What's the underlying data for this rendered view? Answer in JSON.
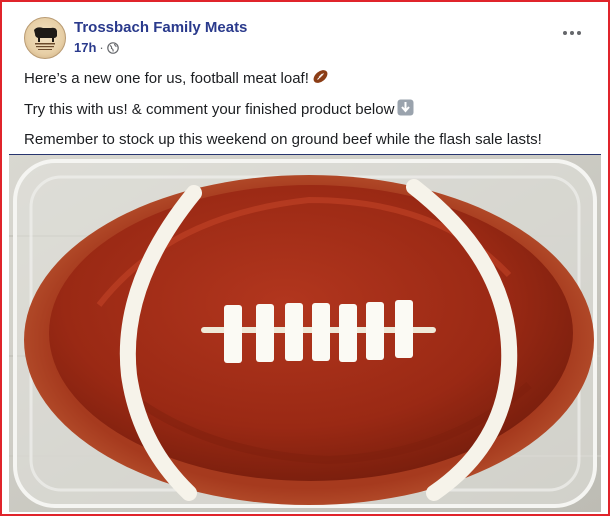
{
  "post": {
    "page_name": "Trossbach Family Meats",
    "time": "17h",
    "separator": "·",
    "privacy_icon": "globe-icon",
    "more_icon": "more-options-icon",
    "lines": [
      "Here’s a new one for us, football meat loaf!",
      "Try this with us! & comment your finished product below",
      "Remember to stock up this weekend on ground beef while the flash sale lasts!"
    ],
    "line_emojis": [
      "football-emoji",
      "down-arrow-emoji",
      ""
    ],
    "image": "football-shaped-meatloaf-photo"
  },
  "colors": {
    "frame_border": "#e0242b",
    "name_color": "#2a3a8c",
    "text_color": "#1c1e21"
  }
}
